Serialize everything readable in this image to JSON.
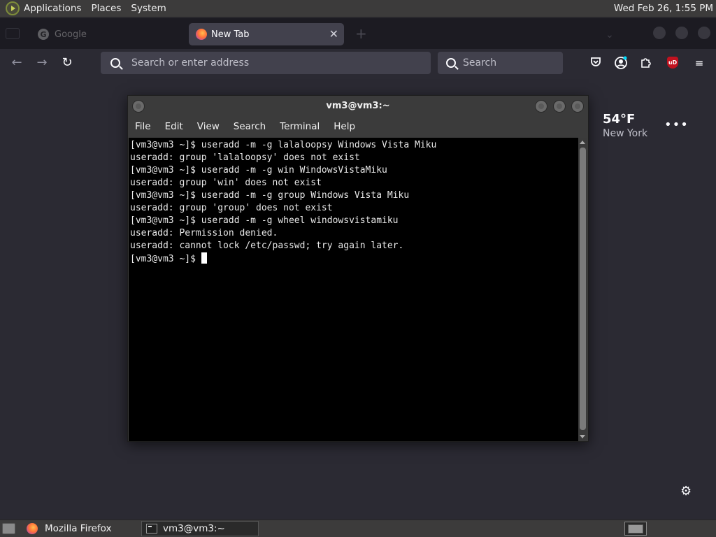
{
  "top_panel": {
    "menus": [
      "Applications",
      "Places",
      "System"
    ],
    "clock": "Wed Feb 26,  1:55 PM"
  },
  "browser": {
    "inactive_tab": {
      "label": "Google",
      "icon": "google-g-icon"
    },
    "active_tab": {
      "label": "New Tab",
      "icon": "firefox-icon"
    },
    "url_placeholder": "Search or enter address",
    "search_placeholder": "Search",
    "toolbar_icons": [
      "pocket-icon",
      "account-icon",
      "extensions-icon",
      "ublock-icon",
      "menu-icon"
    ],
    "ublock_label": "uD"
  },
  "newtab": {
    "weather_temp": "54°F",
    "weather_city": "New York",
    "weather_menu": "•••"
  },
  "terminal": {
    "title": "vm3@vm3:~",
    "menu": [
      "File",
      "Edit",
      "View",
      "Search",
      "Terminal",
      "Help"
    ],
    "lines": [
      "[vm3@vm3 ~]$ useradd -m -g lalaloopsy Windows Vista Miku",
      "useradd: group 'lalaloopsy' does not exist",
      "[vm3@vm3 ~]$ useradd -m -g win WindowsVistaMiku",
      "useradd: group 'win' does not exist",
      "[vm3@vm3 ~]$ useradd -m -g group Windows Vista Miku",
      "useradd: group 'group' does not exist",
      "[vm3@vm3 ~]$ useradd -m -g wheel windowsvistamiku",
      "useradd: Permission denied.",
      "useradd: cannot lock /etc/passwd; try again later."
    ],
    "prompt": "[vm3@vm3 ~]$ "
  },
  "taskbar": {
    "tasks": [
      {
        "label": "Mozilla Firefox",
        "icon": "firefox-icon"
      },
      {
        "label": "vm3@vm3:~",
        "icon": "terminal-icon"
      }
    ]
  }
}
